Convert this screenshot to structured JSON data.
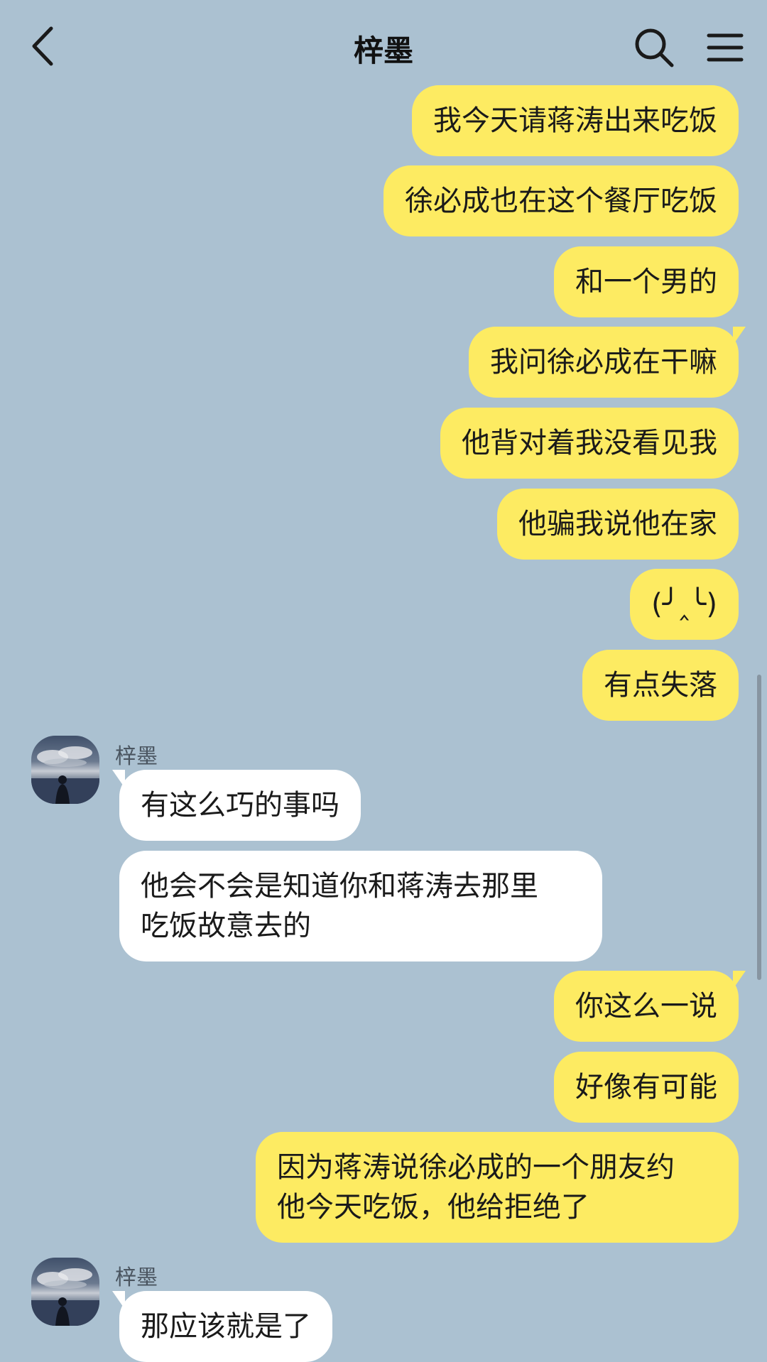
{
  "header": {
    "title": "梓墨"
  },
  "contact": {
    "name": "梓墨"
  },
  "messages": [
    {
      "side": "me",
      "text": "我今天请蒋涛出来吃饭"
    },
    {
      "side": "me",
      "text": "徐必成也在这个餐厅吃饭"
    },
    {
      "side": "me",
      "text": "和一个男的"
    },
    {
      "side": "me",
      "text": "我问徐必成在干嘛"
    },
    {
      "side": "me",
      "text": "他背对着我没看见我"
    },
    {
      "side": "me",
      "text": "他骗我说他在家"
    },
    {
      "side": "me",
      "text": "(╯‸╰)"
    },
    {
      "side": "me",
      "text": "有点失落"
    },
    {
      "side": "them",
      "text": "有这么巧的事吗"
    },
    {
      "side": "them",
      "lines": [
        "他会不会是知道你和蒋涛去那里",
        "吃饭故意去的"
      ]
    },
    {
      "side": "me",
      "text": "你这么一说"
    },
    {
      "side": "me",
      "text": "好像有可能"
    },
    {
      "side": "me",
      "lines": [
        "因为蒋涛说徐必成的一个朋友约",
        "他今天吃饭，他给拒绝了"
      ]
    },
    {
      "side": "them",
      "text": "那应该就是了"
    }
  ]
}
